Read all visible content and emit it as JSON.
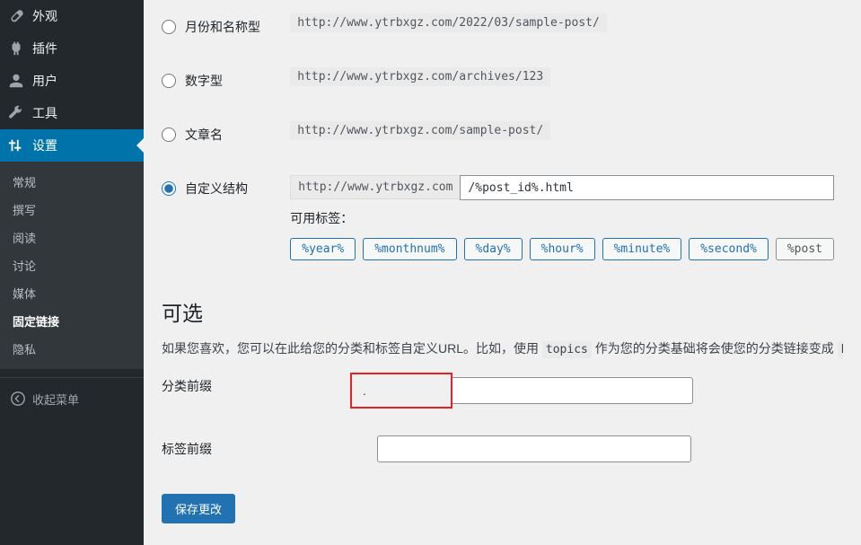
{
  "sidebar": {
    "appearance": "外观",
    "plugins": "插件",
    "users": "用户",
    "tools": "工具",
    "settings": "设置",
    "sub": {
      "general": "常规",
      "writing": "撰写",
      "reading": "阅读",
      "discussion": "讨论",
      "media": "媒体",
      "permalinks": "固定链接",
      "privacy": "隐私"
    },
    "collapse": "收起菜单"
  },
  "permalink": {
    "month_name": {
      "label": "月份和名称型",
      "example": "http://www.ytrbxgz.com/2022/03/sample-post/"
    },
    "numeric": {
      "label": "数字型",
      "example": "http://www.ytrbxgz.com/archives/123"
    },
    "post_name": {
      "label": "文章名",
      "example": "http://www.ytrbxgz.com/sample-post/"
    },
    "custom": {
      "label": "自定义结构",
      "prefix": "http://www.ytrbxgz.com",
      "value": "/%post_id%.html"
    },
    "available_tags": "可用标签：",
    "tags": {
      "year": "%year%",
      "monthnum": "%monthnum%",
      "day": "%day%",
      "hour": "%hour%",
      "minute": "%minute%",
      "second": "%second%",
      "postid": "%post"
    }
  },
  "optional": {
    "heading": "可选",
    "desc_1": "如果您喜欢，您可以在此给您的分类和标签自定义URL。比如，使用 ",
    "desc_code": "topics",
    "desc_2": " 作为您的分类基础将会使您的分类链接变成 ",
    "desc_url": "http://www.y",
    "category_base": {
      "label": "分类前缀",
      "value": "."
    },
    "tag_base": {
      "label": "标签前缀",
      "value": ""
    }
  },
  "submit": "保存更改"
}
